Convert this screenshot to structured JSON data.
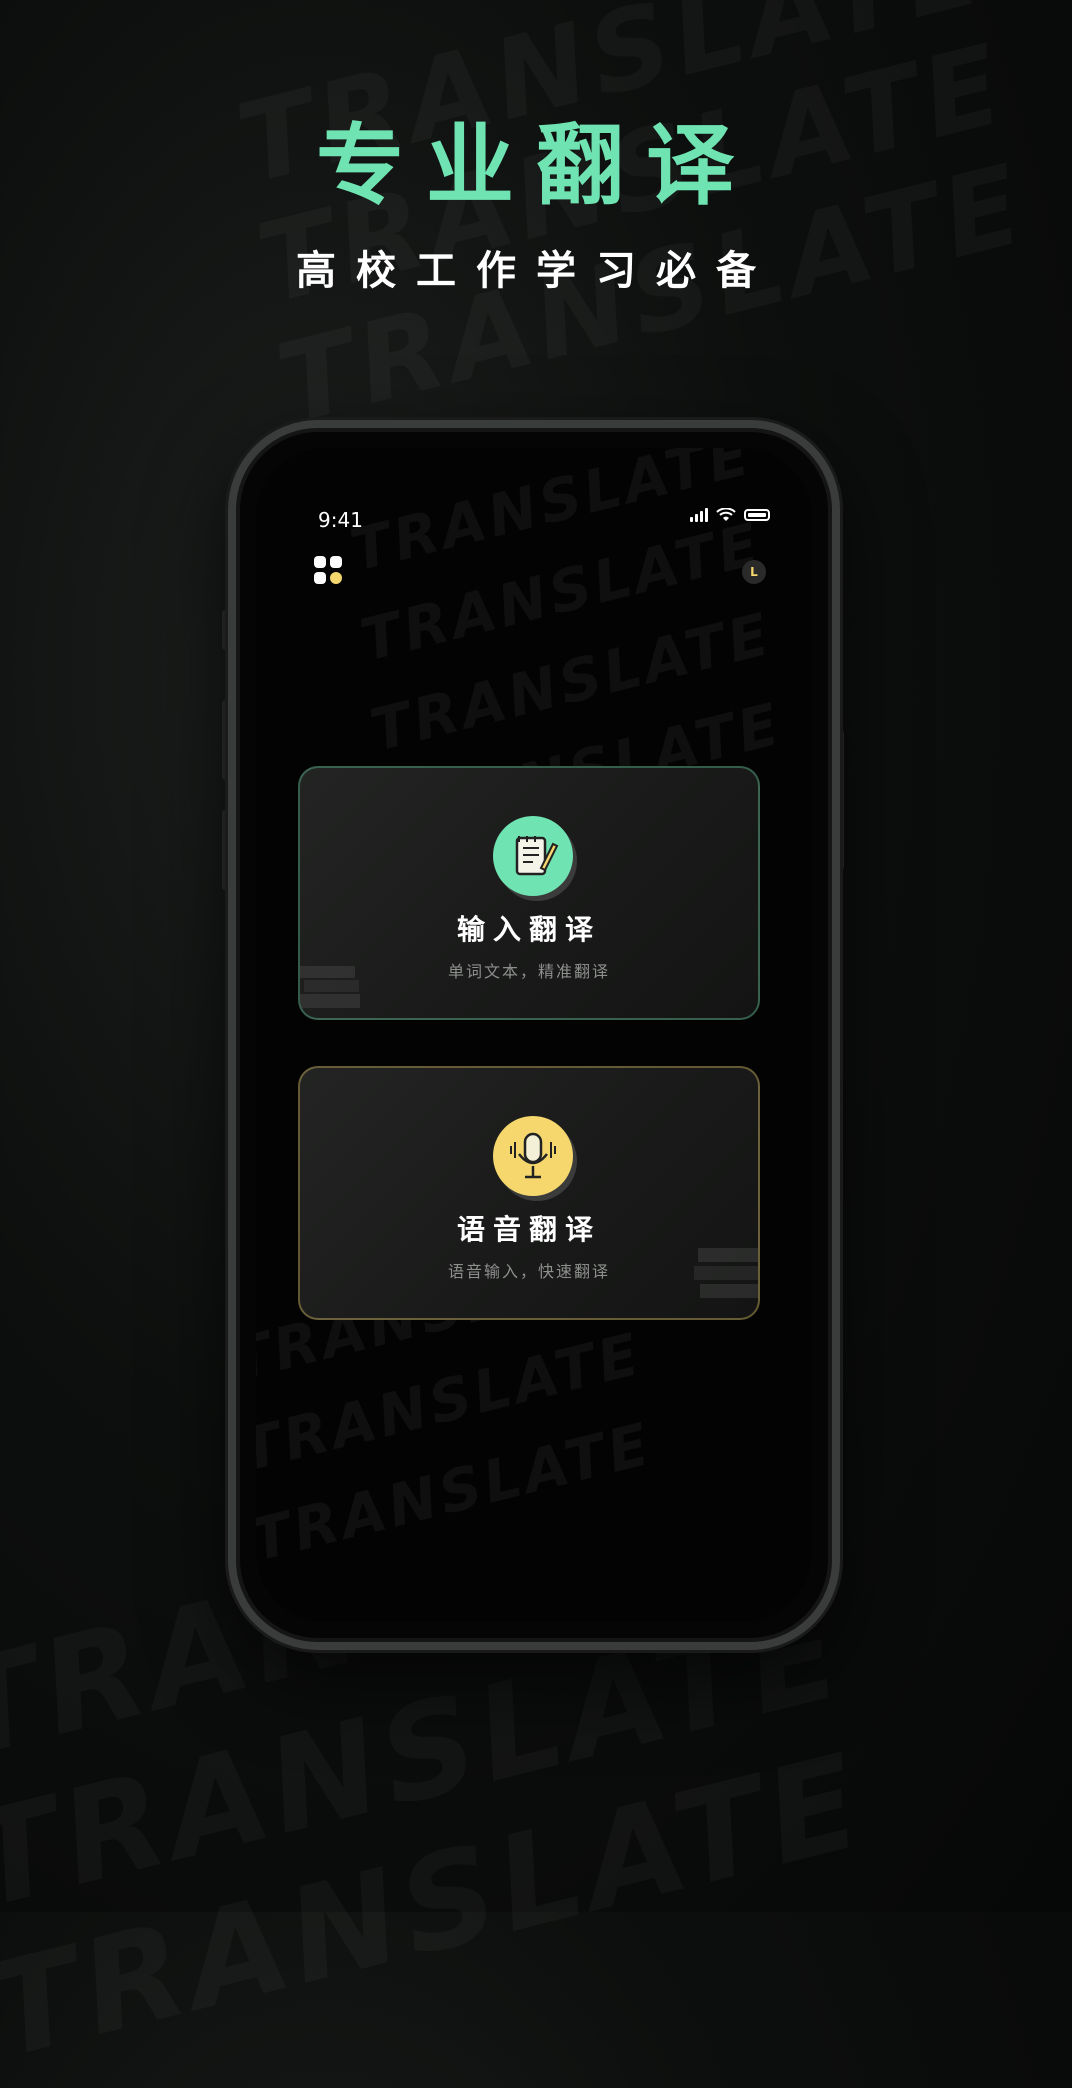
{
  "hero": {
    "title": "专业翻译",
    "subtitle": "高校工作学习必备"
  },
  "background_word": "TRANSLATE",
  "status_bar": {
    "time": "9:41"
  },
  "cards": [
    {
      "title": "输入翻译",
      "subtitle": "单词文本，精准翻译",
      "accent": "#6fe3b1",
      "icon": "notebook-pen-icon"
    },
    {
      "title": "语音翻译",
      "subtitle": "语音输入，快速翻译",
      "accent": "#f5d76e",
      "icon": "microphone-icon"
    }
  ],
  "colors": {
    "accent_green": "#6fe3b1",
    "accent_yellow": "#f5d76e",
    "background": "#0d0f0e"
  }
}
